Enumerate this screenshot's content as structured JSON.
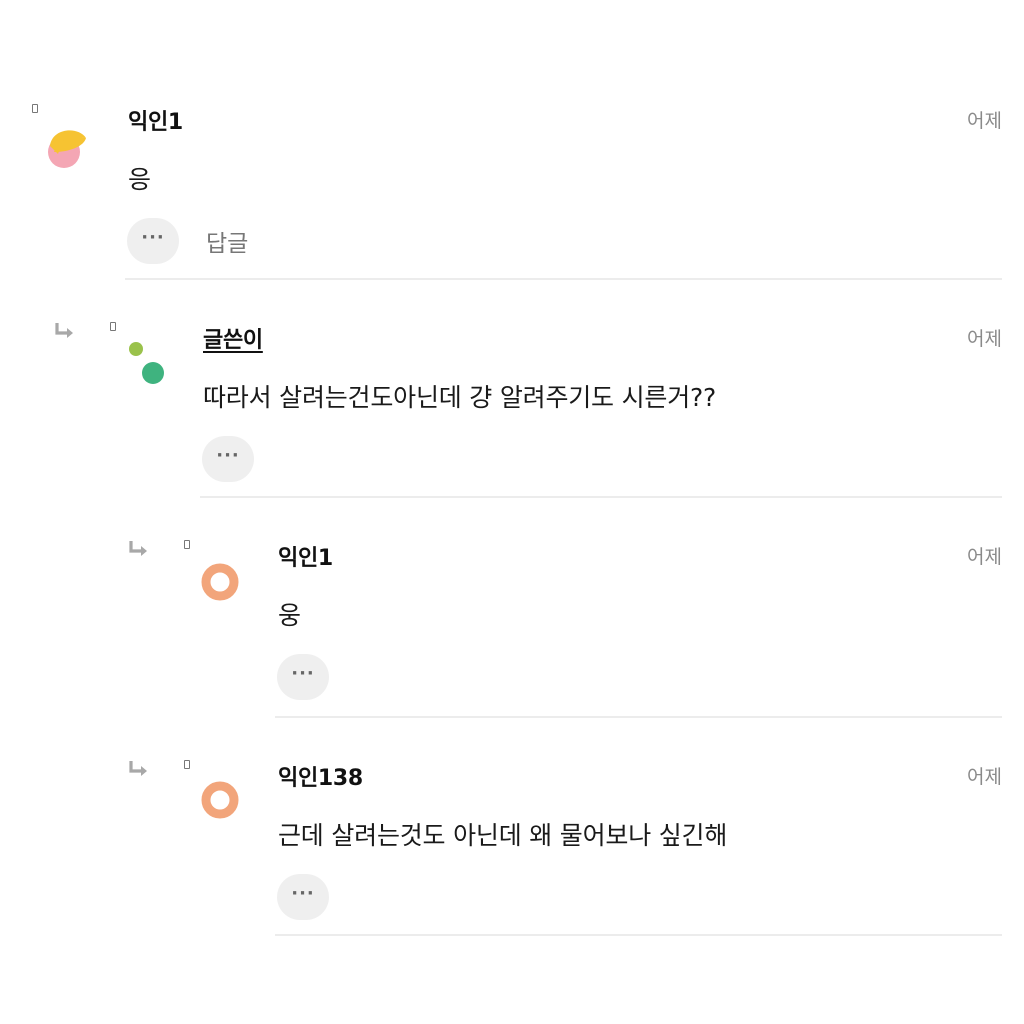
{
  "comments": [
    {
      "author": "익인1",
      "time": "어제",
      "text": "응",
      "reply_label": "답글",
      "more_label": "···",
      "avatar_colors": {
        "top": "#f6c332",
        "bottom": "#f4a6b4"
      }
    },
    {
      "author": "글쓴이",
      "time": "어제",
      "text": "따라서 살려는건도아닌데 걍 알려주기도 시른거??",
      "more_label": "···",
      "avatar_colors": {
        "small": "#9ac24b",
        "large": "#3fb37f"
      }
    },
    {
      "author": "익인1",
      "time": "어제",
      "text": "웅",
      "more_label": "···",
      "avatar_colors": {
        "ring": "#f2a57b"
      }
    },
    {
      "author": "익인138",
      "time": "어제",
      "text": "근데 살려는것도 아닌데 왜 물어보나 싶긴해",
      "more_label": "···",
      "avatar_colors": {
        "ring": "#f2a57b"
      }
    }
  ]
}
